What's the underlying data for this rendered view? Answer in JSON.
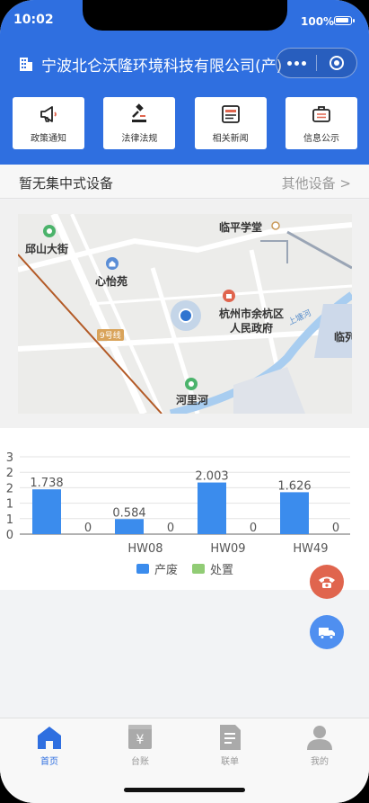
{
  "status_bar": {
    "time": "10:02",
    "battery": "100%"
  },
  "header": {
    "company_name": "宁波北仑沃隆环境科技有限公司(产)"
  },
  "quick_links": [
    {
      "label": "政策通知",
      "icon": "megaphone-icon"
    },
    {
      "label": "法律法规",
      "icon": "gavel-icon"
    },
    {
      "label": "相关新闻",
      "icon": "news-icon"
    },
    {
      "label": "信息公示",
      "icon": "briefcase-icon"
    }
  ],
  "device_row": {
    "title": "暂无集中式设备",
    "more_label": "其他设备 >"
  },
  "map": {
    "labels": {
      "qiushan": "邱山大街",
      "linping": "临平学堂",
      "xinyi": "心怡苑",
      "gov_line1": "杭州市余杭区",
      "gov_line2": "人民政府",
      "line9": "9号线",
      "heli": "河里河",
      "lin_edge": "临列",
      "river": "上塘河"
    }
  },
  "chart_data": {
    "type": "bar",
    "categories": [
      "",
      "HW08",
      "HW09",
      "HW49"
    ],
    "series": [
      {
        "name": "产废",
        "color": "#3b8ced",
        "values": [
          1.738,
          0.584,
          2.003,
          1.626
        ]
      },
      {
        "name": "处置",
        "color": "#91cc75",
        "values": [
          0,
          0,
          0,
          0
        ]
      }
    ],
    "value_labels": [
      [
        "1.738",
        "0.584",
        "2.003",
        "1.626"
      ],
      [
        "0",
        "0",
        "0",
        "0"
      ]
    ],
    "ylim": [
      0,
      3
    ],
    "yticks": [
      "0",
      "1",
      "1",
      "2",
      "2",
      "3"
    ],
    "legend_position": "bottom"
  },
  "tabs": [
    {
      "label": "首页",
      "icon": "home-icon",
      "active": true
    },
    {
      "label": "台账",
      "icon": "ledger-icon",
      "active": false
    },
    {
      "label": "联单",
      "icon": "document-icon",
      "active": false
    },
    {
      "label": "我的",
      "icon": "user-icon",
      "active": false
    }
  ]
}
